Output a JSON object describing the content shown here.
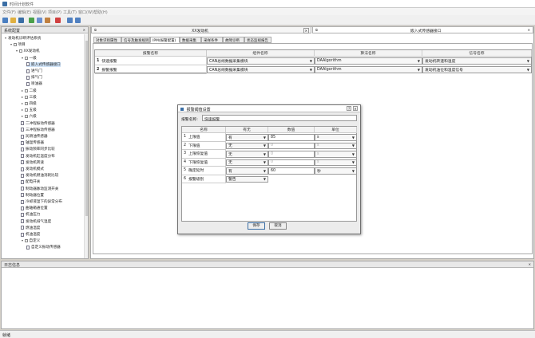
{
  "app": {
    "title": "时间计划软件"
  },
  "menu": [
    "文件(F)",
    "编辑(E)",
    "视图(V)",
    "项目(P)",
    "工具(T)",
    "窗口(W)",
    "帮助(H)"
  ],
  "left_panel": {
    "title": "系统配置"
  },
  "tree": [
    {
      "label": "发动机诊断评估系统",
      "level": 0,
      "exp": "▾"
    },
    {
      "label": "项目",
      "level": 1,
      "exp": "▾",
      "cb": true
    },
    {
      "label": "XX发动机",
      "level": 2,
      "exp": "▾",
      "cb": true
    },
    {
      "label": "一级",
      "level": 3,
      "exp": "▾",
      "cb": true
    },
    {
      "label": "嵌入式传感器接口",
      "level": 4,
      "file": true,
      "sel": true
    },
    {
      "label": "进气门",
      "level": 4,
      "file": true
    },
    {
      "label": "排气门",
      "level": 4,
      "file": true
    },
    {
      "label": "喷油器",
      "level": 4,
      "file": true
    },
    {
      "label": "二级",
      "level": 3,
      "exp": "▸",
      "cb": true
    },
    {
      "label": "三级",
      "level": 3,
      "exp": "▸",
      "cb": true
    },
    {
      "label": "四级",
      "level": 3,
      "exp": "▸",
      "cb": true
    },
    {
      "label": "五级",
      "level": 3,
      "exp": "▸",
      "cb": true
    },
    {
      "label": "六级",
      "level": 3,
      "exp": "▸",
      "cb": true
    },
    {
      "label": "二冲程振动传感器",
      "level": 3,
      "file": true
    },
    {
      "label": "三冲程振动传感器",
      "level": 3,
      "file": true
    },
    {
      "label": "润滑油传感器",
      "level": 3,
      "file": true
    },
    {
      "label": "轴温传感器",
      "level": 3,
      "file": true
    },
    {
      "label": "振动频率同步比较",
      "level": 3,
      "file": true
    },
    {
      "label": "发动机缸温度分布",
      "level": 3,
      "file": true
    },
    {
      "label": "发动机转速",
      "level": 3,
      "file": true
    },
    {
      "label": "发动机模式",
      "level": 3,
      "file": true
    },
    {
      "label": "发动机燃油消耗比较",
      "level": 3,
      "file": true
    },
    {
      "label": "配电开关",
      "level": 3,
      "file": true
    },
    {
      "label": "制动器脉动监测开关",
      "level": 3,
      "file": true
    },
    {
      "label": "制动器位置",
      "level": 3,
      "file": true
    },
    {
      "label": "冷却液温下的异常分布",
      "level": 3,
      "file": true
    },
    {
      "label": "曲轴箱通位置",
      "level": 3,
      "file": true
    },
    {
      "label": "机油压力",
      "level": 3,
      "file": true
    },
    {
      "label": "发动机排气温度",
      "level": 3,
      "file": true
    },
    {
      "label": "燃油温度",
      "level": 3,
      "file": true
    },
    {
      "label": "机油温度",
      "level": 3,
      "file": true
    },
    {
      "label": "自定义",
      "level": 3,
      "exp": "▾",
      "cb": true
    },
    {
      "label": "自定义振动传感器",
      "level": 4,
      "file": true
    }
  ],
  "doc_tabs": [
    {
      "label": "XX发动机"
    },
    {
      "label": "嵌入式传感器接口"
    }
  ],
  "sub_tabs": [
    "对象识别属性",
    "信号及触发规则",
    "IPM(报警配置)",
    "数据采集",
    "采样条件",
    "故障诊断",
    "状态监视报告"
  ],
  "grid": {
    "headers": [
      "报警名称",
      "组件名称",
      "算法名称",
      "信号名称"
    ],
    "rows": [
      {
        "num": "1",
        "name": "快速报警",
        "comp": "CAN总线数据采集模块",
        "alg": "DAAlgorithm",
        "sig": "发动机转速和温度"
      },
      {
        "num": "2",
        "name": "报警报警",
        "comp": "CAN总线数据采集模块",
        "alg": "DAAlgorithm",
        "sig": "发动机油位和温度信号"
      }
    ]
  },
  "dialog": {
    "title": "报警阈值设置",
    "name_label": "报警名称:",
    "name_value": "快速报警",
    "headers": [
      "名称",
      "有无",
      "数值",
      "单位"
    ],
    "rows": [
      {
        "num": "1",
        "name": "上限值",
        "has": "有",
        "val": "85",
        "unit": "s",
        "dis": false
      },
      {
        "num": "2",
        "name": "下限值",
        "has": "无",
        "val": "0",
        "unit": "s",
        "dis": true
      },
      {
        "num": "3",
        "name": "上限恢复值",
        "has": "无",
        "val": "0",
        "unit": "s",
        "dis": true
      },
      {
        "num": "4",
        "name": "下限恢复值",
        "has": "无",
        "val": "0",
        "unit": "s",
        "dis": true
      },
      {
        "num": "5",
        "name": "确定延时",
        "has": "有",
        "val": "60",
        "unit": "秒",
        "dis": false
      },
      {
        "num": "6",
        "name": "报警级别",
        "has": "警告",
        "val": "",
        "unit": "",
        "dis": false
      }
    ],
    "ok": "保存",
    "cancel": "取消"
  },
  "log_panel": {
    "title": "日志信息"
  },
  "status": {
    "text": "就绪"
  },
  "colors": {
    "accent": "#3a6ea5",
    "selection": "#cfe3f7"
  }
}
